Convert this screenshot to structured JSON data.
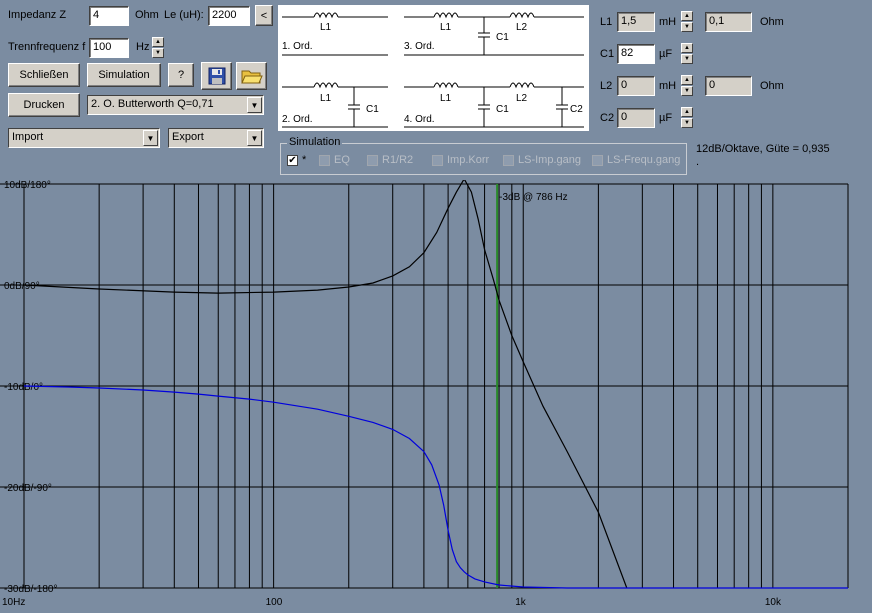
{
  "inputs": {
    "impedance_label": "Impedanz Z",
    "impedance_value": "4",
    "impedance_unit": "Ohm",
    "le_label": "Le (uH):",
    "le_value": "2200",
    "le_button": "<",
    "freq_label": "Trennfrequenz f",
    "freq_value": "100",
    "freq_unit": "Hz"
  },
  "buttons": {
    "close_label": "Schließen",
    "simulation_label": "Simulation",
    "help_label": "?",
    "print_label": "Drucken"
  },
  "filter_select": "2. O. Butterworth Q=0,71",
  "import_select": "Import",
  "export_select": "Export",
  "schematic": {
    "order1": "1. Ord.",
    "order2": "2. Ord.",
    "order3": "3. Ord.",
    "order4": "4. Ord.",
    "L1": "L1",
    "L2": "L2",
    "C1": "C1",
    "C2": "C2"
  },
  "components": {
    "L1": {
      "label": "L1",
      "value": "1,5",
      "unit": "mH",
      "res_value": "0,1",
      "res_unit": "Ohm"
    },
    "C1": {
      "label": "C1",
      "value": "82",
      "unit": "µF"
    },
    "L2": {
      "label": "L2",
      "value": "0",
      "unit": "mH",
      "res_value": "0",
      "res_unit": "Ohm"
    },
    "C2": {
      "label": "C2",
      "value": "0",
      "unit": "µF"
    }
  },
  "info_text": "12dB/Oktave, Güte = 0,935",
  "info_text2": ".",
  "simulation": {
    "title": "Simulation",
    "options": [
      {
        "label": "*",
        "checked": true
      },
      {
        "label": "EQ",
        "checked": false
      },
      {
        "label": "R1/R2",
        "checked": false
      },
      {
        "label": "Imp.Korr",
        "checked": false
      },
      {
        "label": "LS-Imp.gang",
        "checked": false
      },
      {
        "label": "LS-Frequ.gang",
        "checked": false
      }
    ]
  },
  "chart_data": {
    "type": "line",
    "x_scale": "log",
    "xlim": [
      10,
      20000
    ],
    "x_tick_labels": [
      "10Hz",
      "100",
      "1k",
      "10k"
    ],
    "y_tick_labels": [
      "10dB/180°",
      "0dB/90°",
      "-10dB/0°",
      "-20dB/-90°",
      "-30dB/-180°"
    ],
    "ylim": [
      -30,
      10
    ],
    "grid": true,
    "marker": {
      "label": "-3dB @ 786 Hz",
      "x": 786,
      "color": "#2a8a2a"
    },
    "series": [
      {
        "color": "#000000",
        "x": [
          10,
          20,
          40,
          60,
          100,
          150,
          200,
          250,
          300,
          350,
          400,
          450,
          500,
          540,
          580,
          620,
          660,
          700,
          760,
          800,
          900,
          1000,
          1200,
          1500,
          2000,
          2600
        ],
        "y": [
          0,
          -0.4,
          -0.7,
          -0.8,
          -0.7,
          -0.5,
          -0.2,
          0.2,
          0.9,
          1.8,
          3.2,
          5.2,
          7.6,
          9.2,
          10.5,
          9.2,
          6.5,
          3.5,
          0.5,
          -1.5,
          -5,
          -7.6,
          -12,
          -16.5,
          -22.5,
          -30
        ]
      },
      {
        "color": "#0000dd",
        "x": [
          10,
          15,
          20,
          30,
          40,
          50,
          60,
          80,
          100,
          150,
          200,
          250,
          300,
          350,
          400,
          430,
          460,
          480,
          500,
          520,
          540,
          560,
          580,
          600,
          640,
          700,
          800,
          1000,
          1500,
          2000,
          5000,
          20000
        ],
        "y": [
          -10,
          -10.1,
          -10.2,
          -10.4,
          -10.6,
          -10.8,
          -11,
          -11.3,
          -11.6,
          -12.3,
          -13,
          -13.6,
          -14.3,
          -15.2,
          -16.5,
          -17.8,
          -19.8,
          -21.8,
          -24.3,
          -26.2,
          -27.4,
          -28,
          -28.4,
          -28.7,
          -29.1,
          -29.4,
          -29.7,
          -29.9,
          -30,
          -30,
          -30,
          -30
        ]
      }
    ]
  }
}
